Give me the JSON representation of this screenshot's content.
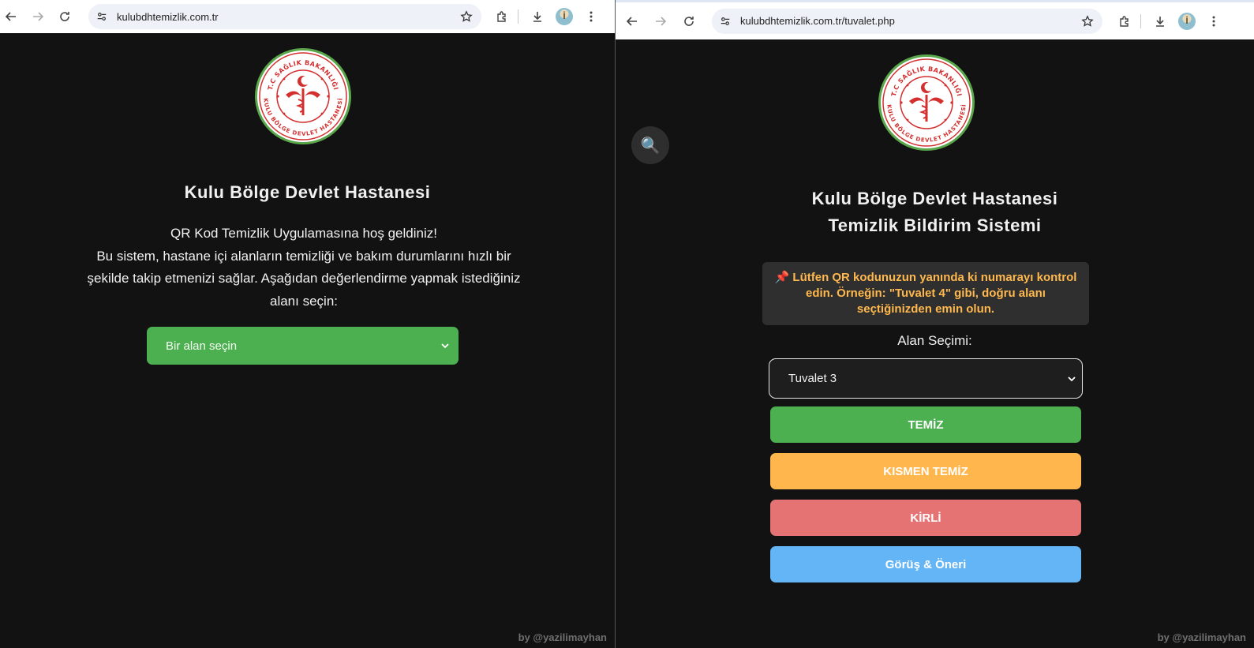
{
  "left": {
    "url": "kulubdhtemizlik.com.tr",
    "title": "Kulu Bölge Devlet Hastanesi",
    "intro_line1": "QR Kod Temizlik Uygulamasına hoş geldiniz!",
    "intro_line2": "Bu sistem, hastane içi alanların temizliği ve bakım durumlarını hızlı bir şekilde takip etmenizi sağlar. Aşağıdan değerlendirme yapmak istediğiniz alanı seçin:",
    "select_value": "Bir alan seçin",
    "footer": "by @yazilimayhan"
  },
  "right": {
    "url": "kulubdhtemizlik.com.tr/tuvalet.php",
    "title_line1": "Kulu Bölge Devlet Hastanesi",
    "title_line2": "Temizlik Bildirim Sistemi",
    "notice": "📌 Lütfen QR kodunuzun yanında ki numarayı kontrol edin. Örneğin: \"Tuvalet 4\" gibi, doğru alanı seçtiğinizden emin olun.",
    "area_label": "Alan Seçimi:",
    "select_value": "Tuvalet 3",
    "buttons": {
      "clean": "TEMİZ",
      "partial": "KISMEN TEMİZ",
      "dirty": "KİRLİ",
      "feedback": "Görüş & Öneri"
    },
    "footer": "by @yazilimayhan"
  },
  "logo": {
    "top_text": "T.C SAĞLIK BAKANLIĞI",
    "bottom_text": "KULU BÖLGE DEVLET HASTANESİ"
  },
  "colors": {
    "background": "#121212",
    "green": "#4caf50",
    "orange": "#ffb74d",
    "red": "#e57373",
    "blue": "#64b5f6",
    "notice_text": "#ffb84d",
    "logo_red": "#d32f2f",
    "logo_ring": "#5aa64a"
  },
  "icons": {
    "back": "back-arrow-icon",
    "forward": "forward-arrow-icon",
    "reload": "reload-icon",
    "site_settings": "tune-icon",
    "bookmark": "star-icon",
    "extensions": "puzzle-icon",
    "downloads": "download-icon",
    "menu": "kebab-menu-icon",
    "search": "magnifier-icon"
  }
}
